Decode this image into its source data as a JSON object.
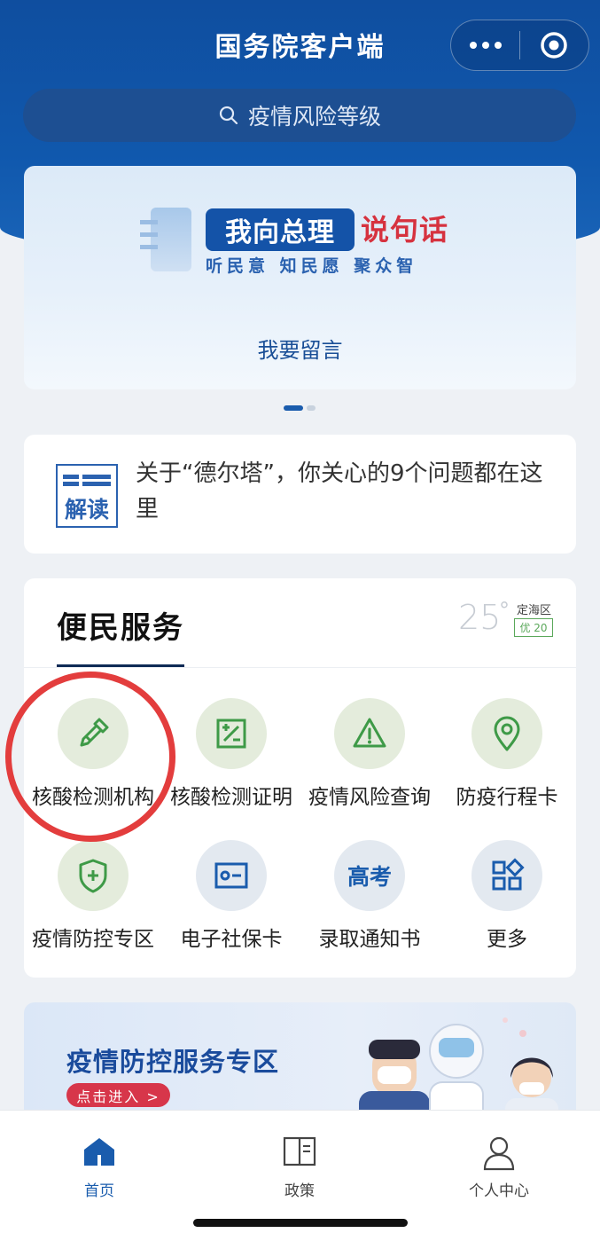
{
  "header": {
    "title": "国务院客户端"
  },
  "search": {
    "placeholder": "疫情风险等级"
  },
  "banner": {
    "tag_blue": "我向总理",
    "tag_red": "说句话",
    "slogan": "听民意 知民愿 聚众智",
    "cta": "我要留言"
  },
  "news": {
    "icon_label": "解读",
    "text": "关于“德尔塔”，你关心的9个问题都在这里"
  },
  "services": {
    "title": "便民服务",
    "weather": {
      "temp": "25",
      "deg": "°",
      "district": "定海区",
      "aqi": "优 20"
    },
    "items": [
      {
        "label": "核酸检测机构",
        "icon": "dropper-icon"
      },
      {
        "label": "核酸检测证明",
        "icon": "certificate-icon"
      },
      {
        "label": "疫情风险查询",
        "icon": "warning-icon"
      },
      {
        "label": "防疫行程卡",
        "icon": "location-pin-icon"
      },
      {
        "label": "疫情防控专区",
        "icon": "shield-plus-icon"
      },
      {
        "label": "电子社保卡",
        "icon": "id-card-icon"
      },
      {
        "label": "录取通知书",
        "icon": "gaokao-icon",
        "icon_text": "高考"
      },
      {
        "label": "更多",
        "icon": "grid-icon"
      }
    ]
  },
  "promo": {
    "title": "疫情防控服务专区",
    "button": "点击进入 >"
  },
  "tabbar": {
    "tabs": [
      {
        "label": "首页",
        "active": true
      },
      {
        "label": "政策"
      },
      {
        "label": "个人中心"
      }
    ]
  },
  "colors": {
    "brand": "#1058ad",
    "accent_red": "#d6323f",
    "service_green": "#3e9a47",
    "service_blue": "#1a5cad"
  }
}
